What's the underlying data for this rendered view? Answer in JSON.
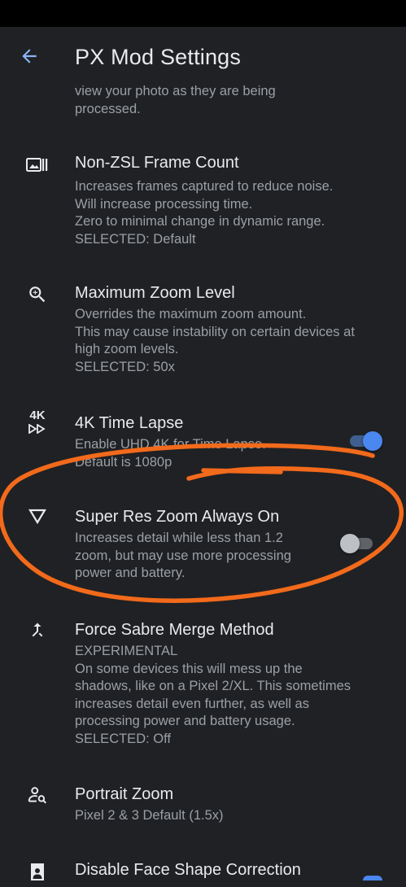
{
  "app_bar": {
    "title": "PX Mod Settings",
    "back_icon": "arrow-back-icon"
  },
  "settings": [
    {
      "title": "",
      "summary": [
        "view your photo as they are being",
        "processed."
      ]
    },
    {
      "icon": "burst-icon",
      "title": "Non-ZSL Frame Count",
      "summary": [
        "Increases frames captured to reduce noise.",
        "Will increase processing time.",
        "Zero to minimal change in dynamic range.",
        "SELECTED: Default"
      ]
    },
    {
      "icon": "zoom-in-icon",
      "title": "Maximum Zoom Level",
      "summary": [
        "Overrides the maximum zoom amount.",
        "This may cause instability on certain devices at",
        "high zoom levels.",
        "SELECTED: 50x"
      ]
    },
    {
      "icon": "4k-timelapse-icon",
      "icon_text": "4K",
      "title": "4K Time Lapse",
      "summary": [
        "Enable UHD 4K for Time Lapse.",
        "Default is 1080p"
      ],
      "toggle": true
    },
    {
      "icon": "triangle-icon",
      "title": "Super Res Zoom Always On",
      "summary": [
        "Increases detail while less than 1.2",
        "zoom, but may use more processing",
        "power and battery."
      ],
      "toggle": false
    },
    {
      "icon": "merge-icon",
      "title": "Force Sabre Merge Method",
      "summary": [
        "EXPERIMENTAL",
        "On some devices this will mess up the",
        "shadows, like on a Pixel 2/XL. This sometimes",
        "increases detail even further, as well as",
        "processing power and battery usage.",
        "SELECTED: Off"
      ]
    },
    {
      "icon": "person-search-icon",
      "title": "Portrait Zoom",
      "summary": [
        "Pixel 2 & 3 Default (1.5x)"
      ]
    },
    {
      "icon": "face-icon",
      "title": "Disable Face Shape Correction",
      "summary": []
    }
  ],
  "colors": {
    "background": "#202124",
    "accent": "#4a87f0",
    "annotation": "#f26a1b"
  }
}
